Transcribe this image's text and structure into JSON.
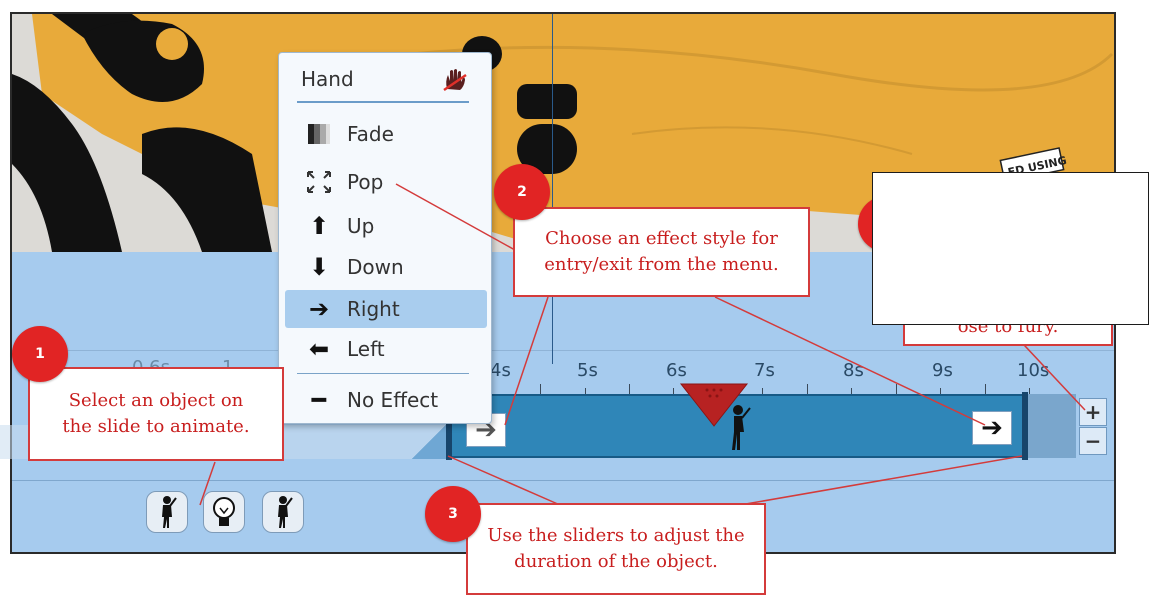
{
  "menu": {
    "title": "Hand",
    "items": [
      {
        "label": "Fade",
        "icon": "fade-icon"
      },
      {
        "label": "Pop",
        "icon": "pop-icon"
      },
      {
        "label": "Up",
        "icon": "arrow-up-icon"
      },
      {
        "label": "Down",
        "icon": "arrow-down-icon"
      },
      {
        "label": "Right",
        "icon": "arrow-right-icon",
        "selected": true
      },
      {
        "label": "Left",
        "icon": "arrow-left-icon"
      },
      {
        "label": "No Effect",
        "icon": "no-effect-icon"
      }
    ]
  },
  "timeline": {
    "ticks": [
      "0.6s",
      "1",
      "4s",
      "5s",
      "6s",
      "7s",
      "8s",
      "9s",
      "10s"
    ],
    "zoom_in": "+",
    "zoom_out": "−"
  },
  "callouts": [
    {
      "number": "1",
      "text": "Select an object on the slide to animate."
    },
    {
      "number": "2",
      "text": "Choose an effect style for entry/exit from the menu."
    },
    {
      "number": "3",
      "text": "Use the sliders to adjust the duration of the object."
    }
  ],
  "partial_text": {
    "stamp": "ED USING",
    "hidden_callout": "ose to fury."
  },
  "colors": {
    "callout_red": "#d43b3b",
    "badge_red": "#e12424",
    "track_blue": "#2f86b8",
    "panel_blue": "#a6cbee",
    "slide_yellow": "#e8aa3a"
  }
}
